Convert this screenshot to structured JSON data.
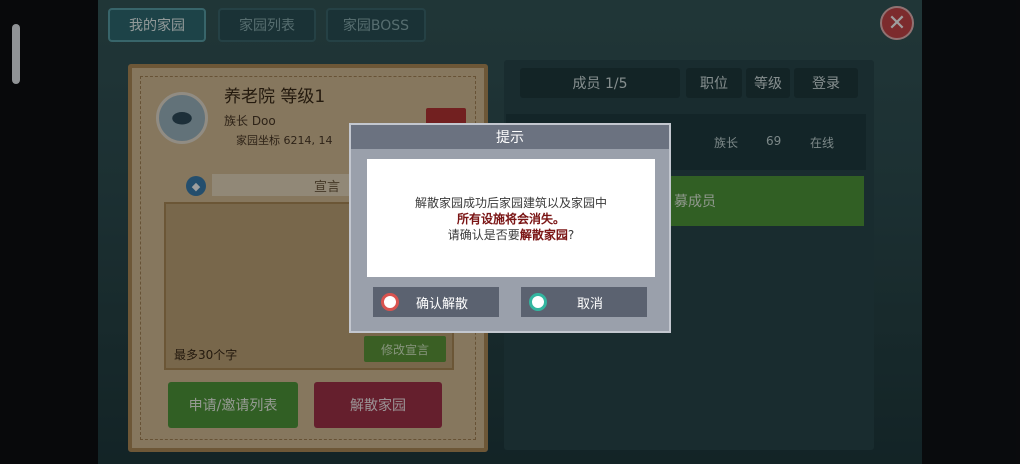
{
  "tabs": [
    {
      "label": "我的家园",
      "active": true
    },
    {
      "label": "家园列表",
      "active": false
    },
    {
      "label": "家园BOSS",
      "active": false
    }
  ],
  "home": {
    "name_level": "养老院 等级1",
    "leader": "族长  Doo",
    "coords": "家园坐标 6214, 14",
    "declaration_title": "宣言",
    "declaration_hint": "最多30个字",
    "edit_button": "修改宣言",
    "apply_invite_button": "申请/邀请列表",
    "disband_button": "解散家园"
  },
  "members": {
    "header_members": "成员 1/5",
    "header_role": "职位",
    "header_level": "等级",
    "header_login": "登录",
    "row": {
      "role": "族长",
      "level": "69",
      "status": "在线"
    },
    "recruit_button": "募成员"
  },
  "dialog": {
    "title": "提示",
    "line1": "解散家园成功后家园建筑以及家园中",
    "line2": "所有设施将会消失。",
    "line3_prefix": "请确认是否要",
    "line3_emph": "解散家园",
    "line3_suffix": "?",
    "confirm": "确认解散",
    "cancel": "取消"
  },
  "colors": {
    "confirm_icon": "#d9534f",
    "cancel_icon": "#33b6a0"
  },
  "icons": {
    "close": "close-icon",
    "avatar": "fish-emblem-icon",
    "declaration": "chat-icon"
  }
}
